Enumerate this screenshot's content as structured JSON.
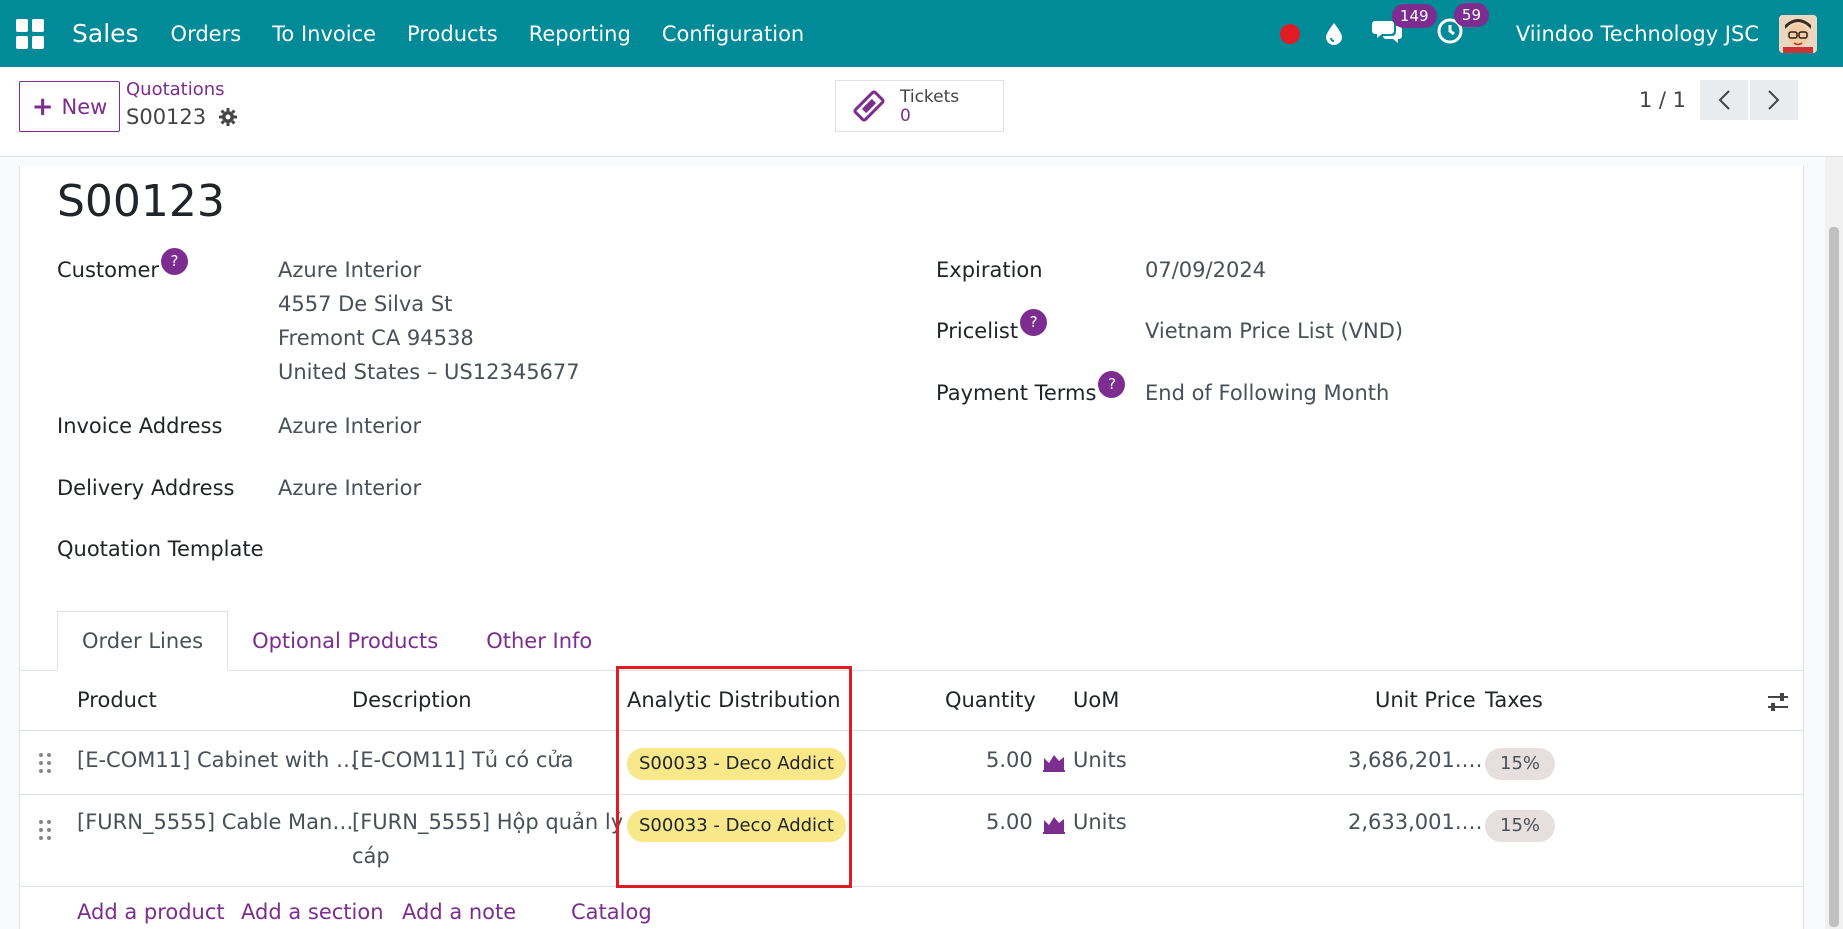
{
  "nav": {
    "app_name": "Sales",
    "menu": [
      "Orders",
      "To Invoice",
      "Products",
      "Reporting",
      "Configuration"
    ],
    "messages_count": "149",
    "activities_count": "59",
    "company": "Viindoo Technology JSC"
  },
  "control": {
    "new_label": "New",
    "breadcrumb": "Quotations",
    "record": "S00123",
    "smart_button": {
      "label": "Tickets",
      "value": "0"
    },
    "pager": "1 / 1"
  },
  "form": {
    "title": "S00123",
    "customer_label": "Customer",
    "customer_lines": [
      "Azure Interior",
      "4557 De Silva St",
      "Fremont CA 94538",
      "United States – US12345677"
    ],
    "invoice_address_label": "Invoice Address",
    "invoice_address": "Azure Interior",
    "delivery_address_label": "Delivery Address",
    "delivery_address": "Azure Interior",
    "quotation_template_label": "Quotation Template",
    "expiration_label": "Expiration",
    "expiration": "07/09/2024",
    "pricelist_label": "Pricelist",
    "pricelist": "Vietnam Price List (VND)",
    "payment_terms_label": "Payment Terms",
    "payment_terms": "End of Following Month",
    "help_mark": "?"
  },
  "tabs": [
    "Order Lines",
    "Optional Products",
    "Other Info"
  ],
  "table": {
    "headers": {
      "product": "Product",
      "description": "Description",
      "analytic": "Analytic Distribution",
      "quantity": "Quantity",
      "uom": "UoM",
      "unit_price": "Unit Price",
      "taxes": "Taxes"
    },
    "rows": [
      {
        "product": "[E-COM11] Cabinet with …",
        "description": "[E-COM11] Tủ có cửa",
        "description_2": "",
        "analytic": "S00033 - Deco Addict",
        "quantity": "5.00",
        "uom": "Units",
        "unit_price": "3,686,201.…",
        "taxes": "15%"
      },
      {
        "product": "[FURN_5555] Cable Man…",
        "description": "[FURN_5555] Hộp quản lý",
        "description_2": "cáp",
        "analytic": "S00033 - Deco Addict",
        "quantity": "5.00",
        "uom": "Units",
        "unit_price": "2,633,001.…",
        "taxes": "15%"
      }
    ],
    "actions": [
      "Add a product",
      "Add a section",
      "Add a note",
      "Catalog"
    ]
  },
  "colors": {
    "topbar": "#018a98",
    "accent": "#7c2d8f",
    "highlight": "#e01b24",
    "tag": "#f8e88a"
  }
}
